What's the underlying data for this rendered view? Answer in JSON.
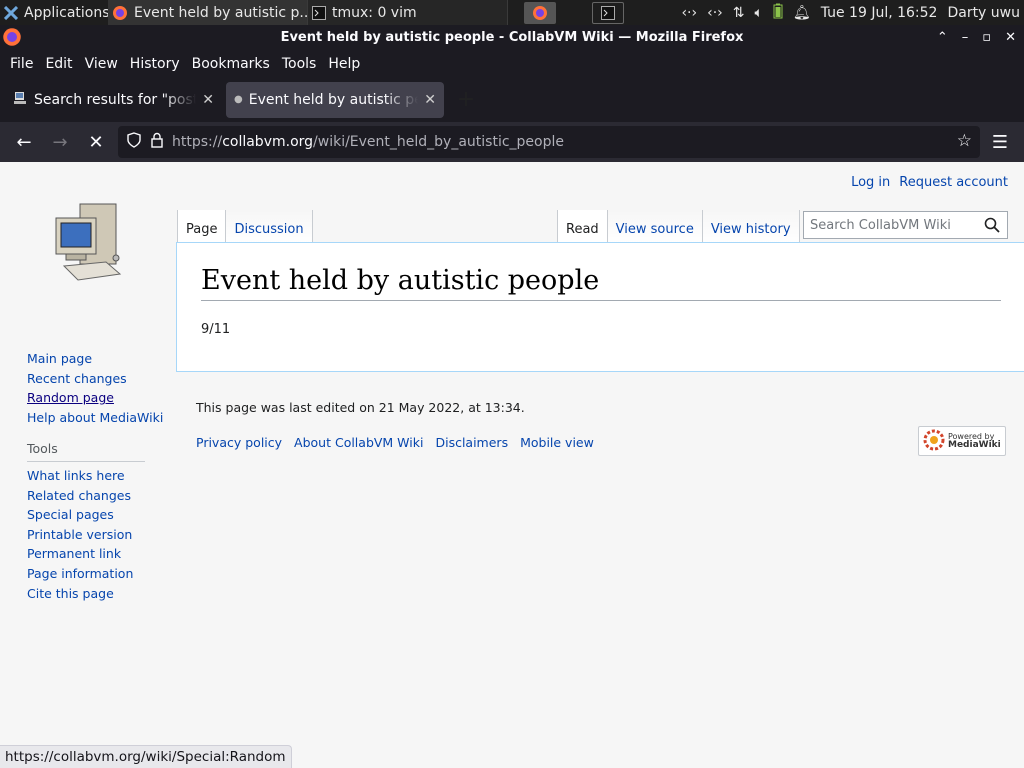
{
  "taskbar": {
    "apps_label": "Applications",
    "windows": [
      {
        "title": "Event held by autistic p..."
      },
      {
        "title": "tmux: 0 vim"
      }
    ],
    "clock": "Tue 19 Jul, 16:52",
    "user": "Darty uwu"
  },
  "window": {
    "title": "Event held by autistic people - CollabVM Wiki — Mozilla Firefox"
  },
  "menubar": {
    "items": [
      {
        "label": "File"
      },
      {
        "label": "Edit"
      },
      {
        "label": "View"
      },
      {
        "label": "History"
      },
      {
        "label": "Bookmarks"
      },
      {
        "label": "Tools"
      },
      {
        "label": "Help"
      }
    ]
  },
  "tabs": [
    {
      "title": "Search results for \"postm"
    },
    {
      "title": "Event held by autistic pe"
    }
  ],
  "navbar": {
    "url_prefix": "https://",
    "url_host": "collabvm.org",
    "url_path": "/wiki/Event_held_by_autistic_people"
  },
  "wiki": {
    "personal": {
      "login": "Log in",
      "request": "Request account"
    },
    "page_tabs": {
      "page": "Page",
      "discussion": "Discussion"
    },
    "view_tabs": {
      "read": "Read",
      "view_source": "View source",
      "view_history": "View history"
    },
    "search_placeholder": "Search CollabVM Wiki",
    "nav": [
      {
        "label": "Main page"
      },
      {
        "label": "Recent changes"
      },
      {
        "label": "Random page"
      },
      {
        "label": "Help about MediaWiki"
      }
    ],
    "tools_heading": "Tools",
    "tools": [
      {
        "label": "What links here"
      },
      {
        "label": "Related changes"
      },
      {
        "label": "Special pages"
      },
      {
        "label": "Printable version"
      },
      {
        "label": "Permanent link"
      },
      {
        "label": "Page information"
      },
      {
        "label": "Cite this page"
      }
    ],
    "heading": "Event held by autistic people",
    "body": "9/11",
    "last_edited": "This page was last edited on 21 May 2022, at 13:34.",
    "footer_links": [
      {
        "label": "Privacy policy"
      },
      {
        "label": "About CollabVM Wiki"
      },
      {
        "label": "Disclaimers"
      },
      {
        "label": "Mobile view"
      }
    ],
    "powered_by": {
      "line1": "Powered by",
      "line2": "MediaWiki"
    }
  },
  "status_url": "https://collabvm.org/wiki/Special:Random"
}
